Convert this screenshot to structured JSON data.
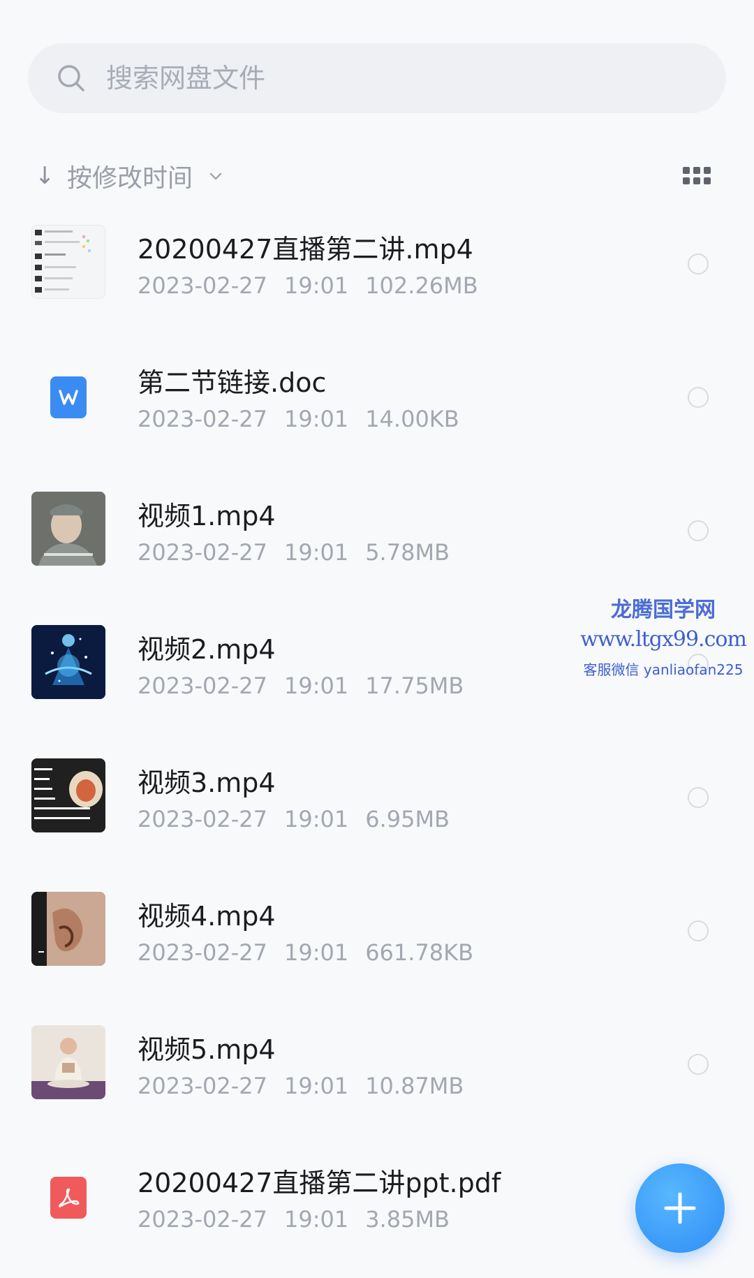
{
  "search": {
    "placeholder": "搜索网盘文件",
    "icon": "search-icon"
  },
  "sort": {
    "arrow": "↓",
    "label": "按修改时间",
    "icon": "chevron-down-icon"
  },
  "view_toggle": {
    "icon": "grid-view-icon"
  },
  "files": [
    {
      "name": "20200427直播第二讲.mp4",
      "date": "2023-02-27",
      "time": "19:01",
      "size": "102.26MB",
      "thumb": "screenshot"
    },
    {
      "name": "第二节链接.doc",
      "date": "2023-02-27",
      "time": "19:01",
      "size": "14.00KB",
      "thumb": "word-icon"
    },
    {
      "name": "视频1.mp4",
      "date": "2023-02-27",
      "time": "19:01",
      "size": "5.78MB",
      "thumb": "video"
    },
    {
      "name": "视频2.mp4",
      "date": "2023-02-27",
      "time": "19:01",
      "size": "17.75MB",
      "thumb": "video"
    },
    {
      "name": "视频3.mp4",
      "date": "2023-02-27",
      "time": "19:01",
      "size": "6.95MB",
      "thumb": "video"
    },
    {
      "name": "视频4.mp4",
      "date": "2023-02-27",
      "time": "19:01",
      "size": "661.78KB",
      "thumb": "video"
    },
    {
      "name": "视频5.mp4",
      "date": "2023-02-27",
      "time": "19:01",
      "size": "10.87MB",
      "thumb": "video"
    },
    {
      "name": "20200427直播第二讲ppt.pdf",
      "date": "2023-02-27",
      "time": "19:01",
      "size": "3.85MB",
      "thumb": "pdf-icon"
    }
  ],
  "watermark": {
    "line1": "龙腾国学网",
    "line2": "www.ltgx99.com",
    "line3": "客服微信 yanliaofan225"
  },
  "fab": {
    "icon": "plus-icon"
  },
  "colors": {
    "accent": "#2f8cf5",
    "word": "#3b8cf2",
    "pdf": "#f15a5a"
  }
}
